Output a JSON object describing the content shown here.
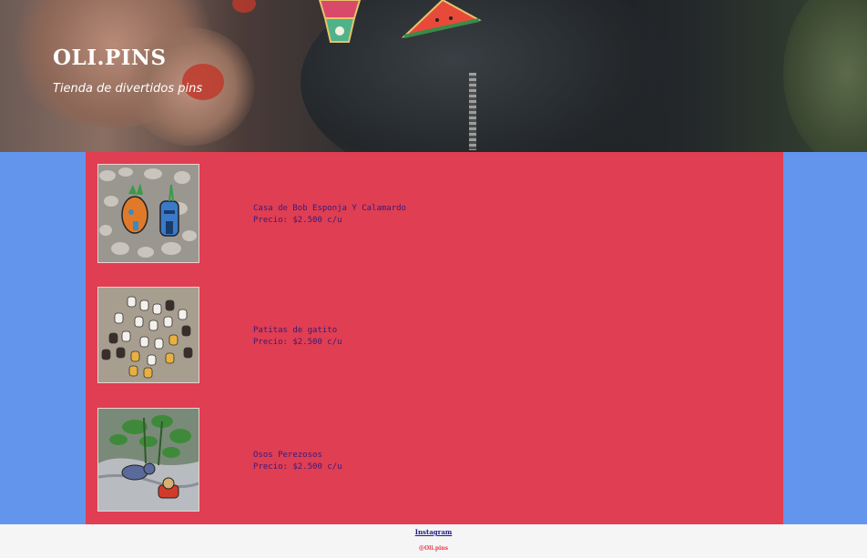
{
  "header": {
    "brand": "OLI.PINS",
    "tagline": "Tienda de divertidos pins",
    "hero_image": "leather-jacket-with-pins-photo"
  },
  "products": [
    {
      "name": "Casa de Bob Esponja Y Calamardo",
      "price": "Precio: $2.500 c/u",
      "image": "pineapple-and-tiki-house-pins-on-pebbles"
    },
    {
      "name": "Patitas de gatito",
      "price": "Precio: $2.500 c/u",
      "image": "cat-paw-pins-on-carpet"
    },
    {
      "name": "Osos Perezosos",
      "price": "Precio: $2.500 c/u",
      "image": "sloth-pins-in-plant-pot"
    }
  ],
  "footer": {
    "instagram_link": "Instagram",
    "handle": "@Oli.pins"
  },
  "colors": {
    "page_background": "#6495ed",
    "panel_background": "#e03e52",
    "footer_background": "#f5f5f5",
    "product_text": "#3a1a7a"
  }
}
